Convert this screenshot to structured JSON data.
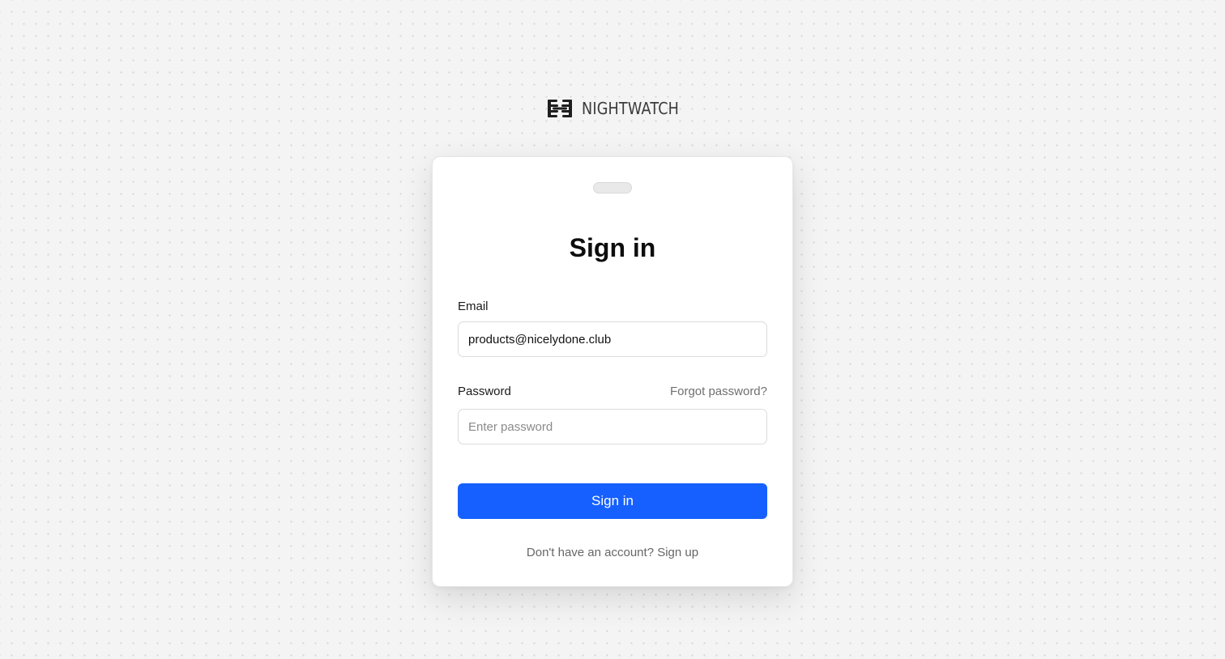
{
  "brand": {
    "name": "NIGHTWATCH",
    "logo_icon": "nightwatch-logo-icon"
  },
  "form": {
    "title": "Sign in",
    "email": {
      "label": "Email",
      "value": "products@nicelydone.club",
      "placeholder": ""
    },
    "password": {
      "label": "Password",
      "value": "",
      "placeholder": "Enter password",
      "forgot_label": "Forgot password?"
    },
    "submit_label": "Sign in",
    "signup": {
      "prompt": "Don't have an account?",
      "link_label": "Sign up"
    }
  },
  "colors": {
    "accent": "#1660ff",
    "background": "#f4f4f4",
    "card": "#ffffff"
  }
}
